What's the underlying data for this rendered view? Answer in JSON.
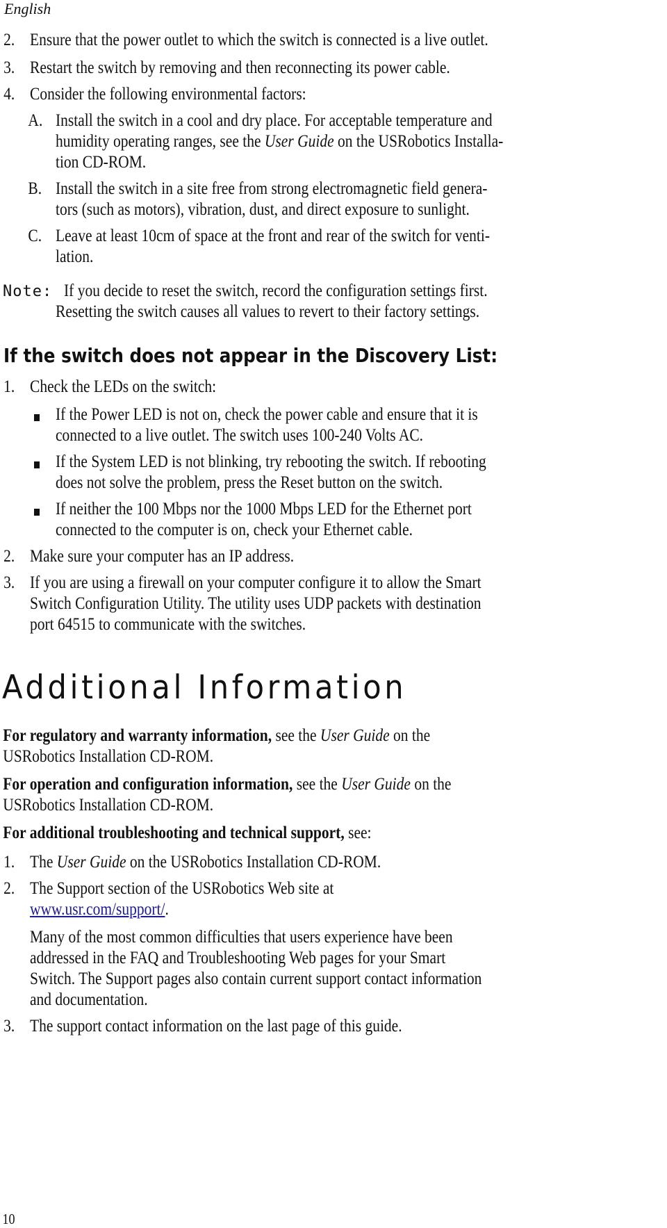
{
  "header": {
    "language": "English"
  },
  "steps_top": [
    {
      "num": "2.",
      "text": "Ensure that the power outlet to which the switch is connected is a live outlet."
    },
    {
      "num": "3.",
      "text": "Restart the switch by removing and then reconnecting its power cable."
    },
    {
      "num": "4.",
      "text": "Consider the following environmental factors:"
    }
  ],
  "env_factors": [
    {
      "letter": "A.",
      "lines": [
        "Install the switch in a cool and dry place. For acceptable temperature and",
        "humidity operating ranges, see the |User Guide| on the USRobotics Installa-",
        "tion CD-ROM."
      ]
    },
    {
      "letter": "B.",
      "lines": [
        "Install the switch in a site free from strong electromagnetic field genera-",
        "tors (such as motors), vibration, dust, and direct exposure to sunlight."
      ]
    },
    {
      "letter": "C.",
      "lines": [
        "Leave at least 10cm of space at the front and rear of the switch for venti-",
        "lation."
      ]
    }
  ],
  "note": {
    "label": "Note:",
    "lines": [
      "If you decide to reset the switch, record the configuration settings first.",
      "Resetting the switch causes all values to revert to their factory settings."
    ]
  },
  "discovery": {
    "heading": "If the switch does not appear in the Discovery List:",
    "step1": {
      "num": "1.",
      "text": "Check the LEDs on the switch:"
    },
    "bullets": [
      {
        "lines": [
          "If the Power LED is not on, check the power cable and ensure that it is",
          "connected to a live outlet. The switch uses 100-240 Volts AC."
        ]
      },
      {
        "lines": [
          "If the System LED is not blinking, try rebooting the switch. If rebooting",
          "does not solve the problem, press the Reset button on the switch."
        ]
      },
      {
        "lines": [
          "If neither the 100 Mbps nor the 1000 Mbps LED for the Ethernet port",
          "connected to the computer is on, check your Ethernet cable."
        ]
      }
    ],
    "step2": {
      "num": "2.",
      "text": "Make sure your computer has an IP address."
    },
    "step3": {
      "num": "3.",
      "lines": [
        "If you are using a firewall on your computer configure it to allow the Smart",
        "Switch Configuration Utility. The utility uses UDP packets with destination",
        "port 64515 to communicate with the switches."
      ]
    }
  },
  "additional": {
    "heading": "Additional Information",
    "regulatory": {
      "bold": "For regulatory and warranty information,",
      "pre": " see the ",
      "italic": "User Guide",
      "post": " on the",
      "line2": "USRobotics Installation CD-ROM."
    },
    "operation": {
      "bold": "For operation and configuration information,",
      "pre": " see the ",
      "italic": "User Guide",
      "post": " on the",
      "line2": "USRobotics Installation CD-ROM."
    },
    "troubleshooting": {
      "bold": "For additional troubleshooting and technical support,",
      "post": " see:"
    },
    "items": [
      {
        "num": "1.",
        "pre": "The ",
        "italic": "User Guide",
        "post": " on the USRobotics Installation CD-ROM."
      },
      {
        "num": "2.",
        "line1": "The Support section of the USRobotics Web site at",
        "link": "www.usr.com/support/",
        "link_suffix": ".",
        "para": [
          "Many of the most common difficulties that users experience have been",
          "addressed in the FAQ and Troubleshooting Web pages for your Smart",
          "Switch. The Support pages also contain current support contact information",
          "and documentation."
        ]
      },
      {
        "num": "3.",
        "text": "The support contact information on the last page of this guide."
      }
    ]
  },
  "footer": {
    "page_number": "10"
  }
}
